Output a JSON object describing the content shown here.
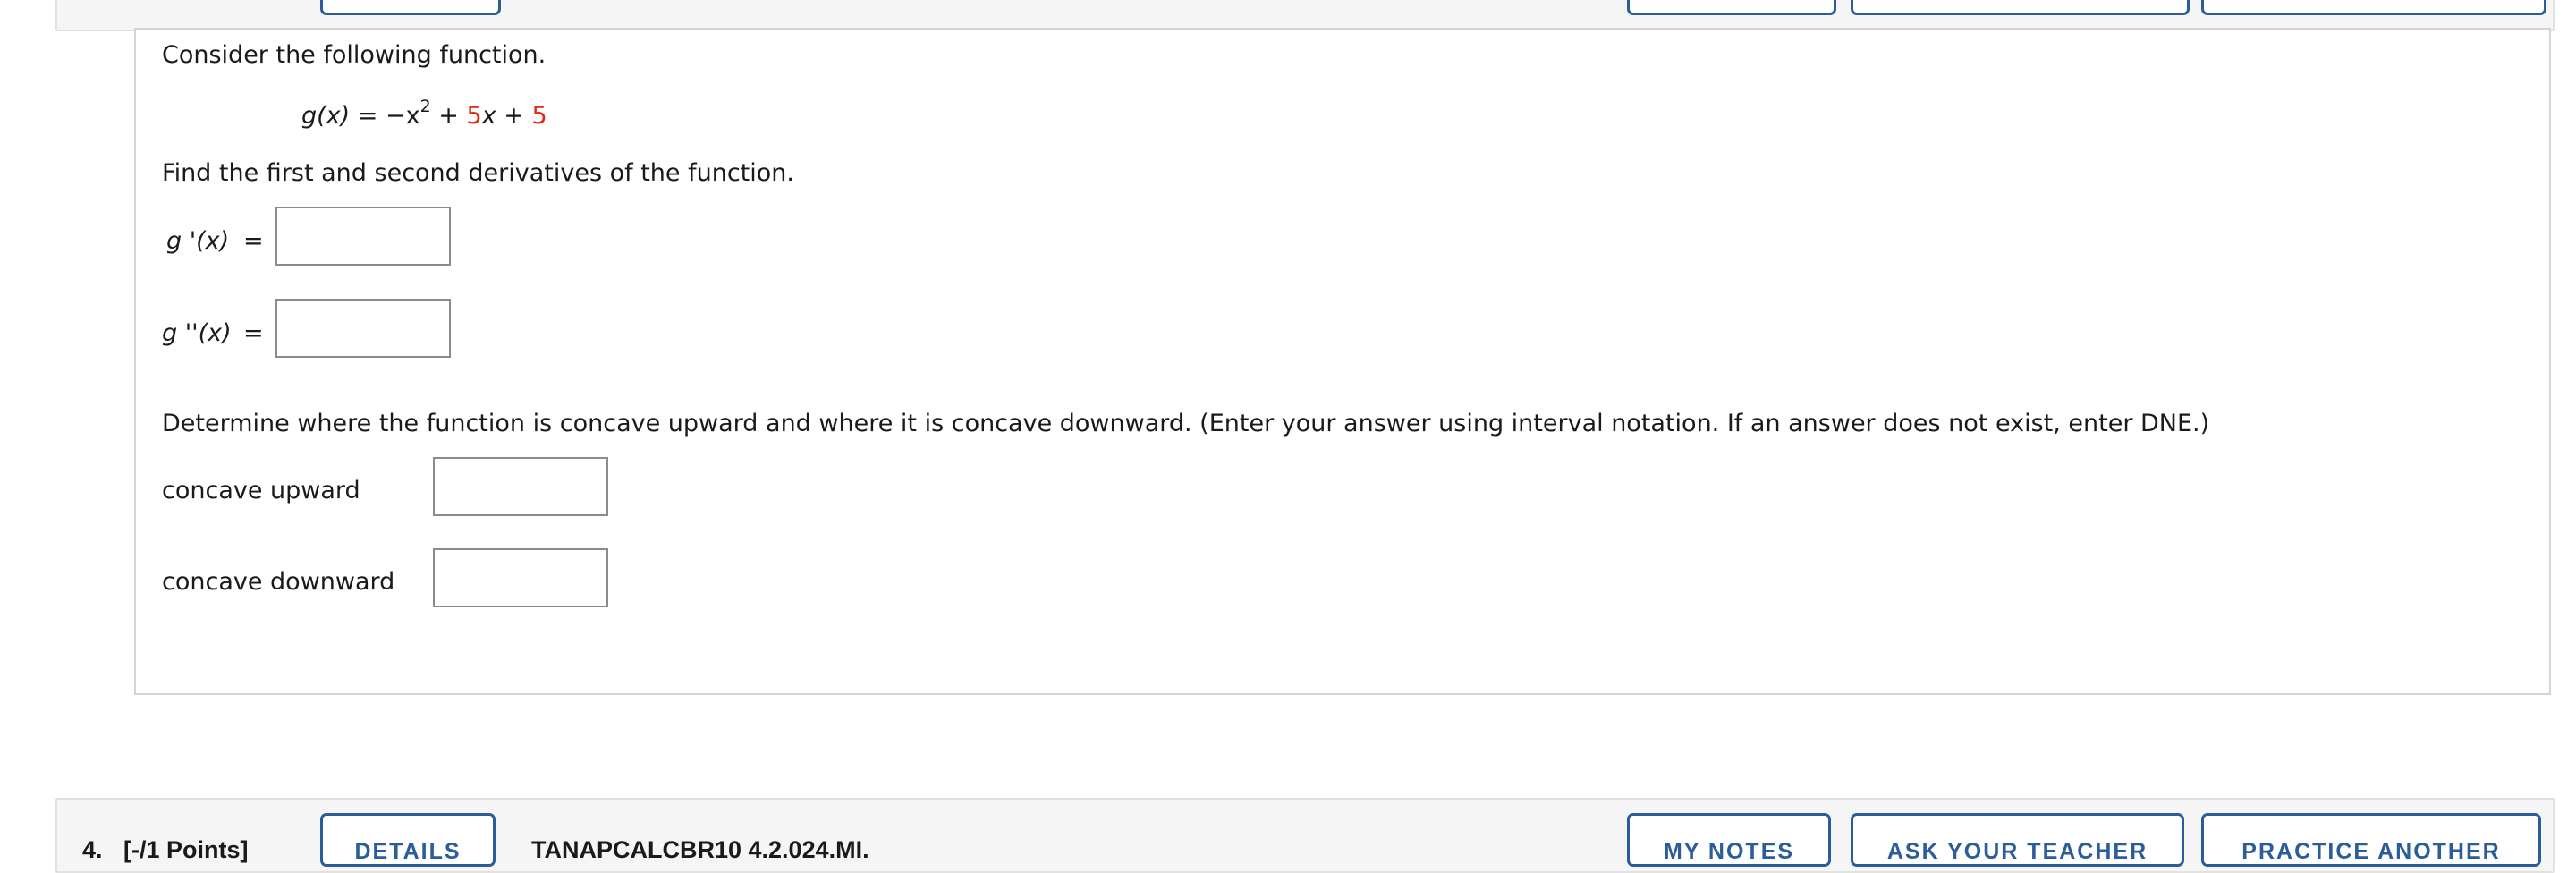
{
  "top_header": {
    "buttons": [
      "",
      "",
      "",
      ""
    ]
  },
  "question": {
    "intro": "Consider the following function.",
    "function": {
      "lhs": "g(x)",
      "eq": "=",
      "neg_term": "−x",
      "exp": "2",
      "plus1": "+",
      "coef": "5",
      "x_var": "x",
      "plus2": "+",
      "const": "5"
    },
    "derivatives_prompt": "Find the first and second derivatives of the function.",
    "first_derivative": {
      "label": "g '(x)",
      "eq": "=",
      "value": ""
    },
    "second_derivative": {
      "label": "g ''(x)",
      "eq": "=",
      "value": ""
    },
    "concavity_prompt": "Determine where the function is concave upward and where it is concave downward. (Enter your answer using interval notation. If an answer does not exist, enter DNE.)",
    "concave_upward": {
      "label": "concave upward",
      "value": ""
    },
    "concave_downward": {
      "label": "concave downward",
      "value": ""
    }
  },
  "next_question": {
    "number": "4.",
    "points": "[-/1 Points]",
    "details_button": "DETAILS",
    "problem_id": "TANAPCALCBR10 4.2.024.MI.",
    "my_notes_button": "MY NOTES",
    "ask_teacher_button": "ASK YOUR TEACHER",
    "practice_button": "PRACTICE ANOTHER"
  },
  "colors": {
    "highlight_red": "#e0280f",
    "button_blue": "#2a5d9a",
    "header_bg": "#f5f5f5"
  }
}
